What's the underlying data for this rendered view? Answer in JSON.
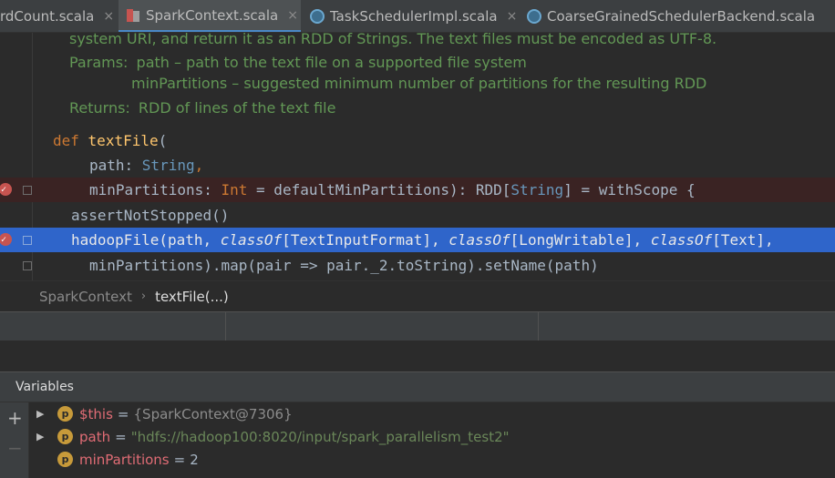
{
  "tabs": [
    {
      "label": "rdCount.scala",
      "close": "×"
    },
    {
      "label": "SparkContext.scala",
      "close": "×"
    },
    {
      "label": "TaskSchedulerImpl.scala",
      "close": "×"
    },
    {
      "label": "CoarseGrainedSchedulerBackend.scala",
      "close": ""
    }
  ],
  "doc": {
    "line0": "system URI, and return it as an RDD of Strings. The text files must be encoded as UTF-8.",
    "params_label": "Params:",
    "param1": "path – path to the text file on a supported file system",
    "param2": "minPartitions – suggested minimum number of partitions for the resulting RDD",
    "returns_label": "Returns:",
    "returns": "RDD of lines of the text file"
  },
  "code": {
    "l1_kw": "def",
    "l1_fn": "textFile",
    "l1_rest": "(",
    "l2_name": "path",
    "l2_colon": ": ",
    "l2_type": "String",
    "l2_end": ",",
    "l3_name": "minPartitions",
    "l3_colon": ": ",
    "l3_type": "Int",
    "l3_mid": " = defaultMinPartitions): RDD[",
    "l3_type2": "String",
    "l3_end": "] = withScope {",
    "l4": "assertNotStopped()",
    "l5_a": "hadoopFile(path, ",
    "l5_b": "classOf",
    "l5_c": "[TextInputFormat], ",
    "l5_d": "classOf",
    "l5_e": "[LongWritable], ",
    "l5_f": "classOf",
    "l5_g": "[Text],",
    "l6": "minPartitions).map(pair => pair._2.toString).setName(path)"
  },
  "breadcrumb": {
    "item1": "SparkContext",
    "sep": "›",
    "item2": "textFile(...)"
  },
  "variables": {
    "title": "Variables",
    "add": "+",
    "remove": "−",
    "badge": "p",
    "rows": [
      {
        "name": "$this",
        "eq": "=",
        "value": "{SparkContext@7306}"
      },
      {
        "name": "path",
        "eq": "=",
        "value": "\"hdfs://hadoop100:8020/input/spark_parallelism_test2\""
      },
      {
        "name": "minPartitions",
        "eq": "=",
        "value": "2"
      }
    ]
  }
}
